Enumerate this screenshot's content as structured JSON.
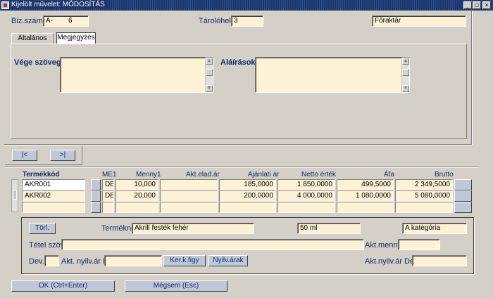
{
  "window": {
    "title": "Kijelölt művelet: MÓDOSÍTÁS",
    "minimize": "_",
    "maximize": "□",
    "close": "×"
  },
  "header": {
    "biz_szam_label": "Biz.szám",
    "biz_szam_prefix": "A-",
    "biz_szam_value": "6",
    "tarolohely_label": "Tárolóhely",
    "tarolohely_value": "3",
    "raktar_value": "Főraktár"
  },
  "tabs": [
    {
      "label": "Általános"
    },
    {
      "label": "Megjegyzés"
    }
  ],
  "notes": {
    "vege_szoveg_label": "Vége szöveg",
    "alairasok_label": "Aláírások",
    "scroll_up": "▲",
    "scroll_down": "▼"
  },
  "nav": {
    "first": "|<",
    "last": ">|"
  },
  "grid": {
    "columns": [
      "Termékkód",
      "ME1",
      "Menny1",
      "Akt.elad.ár",
      "Ajánlati ár",
      "Netto érték",
      "Áfa",
      "Brutto"
    ],
    "rows": [
      {
        "kod": "AKR001",
        "me": "DB",
        "menny": "10,000",
        "akt_ar": "",
        "ajanl": "185,0000",
        "netto": "1 850,0000",
        "afa": "499,5000",
        "brutto": "2 349,5000"
      },
      {
        "kod": "AKR002",
        "me": "DB",
        "menny": "20,000",
        "akt_ar": "",
        "ajanl": "200,0000",
        "netto": "4 000,0000",
        "afa": "1 080,0000",
        "brutto": "5 080,0000"
      },
      {
        "kod": "",
        "me": "",
        "menny": "",
        "akt_ar": "",
        "ajanl": "",
        "netto": "",
        "afa": "",
        "brutto": ""
      }
    ]
  },
  "detail": {
    "torl_label": "Törl.",
    "termeknev_label": "Terméknév",
    "termeknev_value": "Akrill festék fehér",
    "kiszereles_value": "50 ml",
    "kategoria_value": "A kategória",
    "tetel_szov_label": "Tétel szöv.",
    "tetel_szov_value": "",
    "akt_menny_label": "Akt.menny",
    "akt_menny_value": "",
    "dev_label": "Dev.:",
    "dev_value": "",
    "akt_nyilv_ar_ft_label": "Akt. nyilv.ár Ft.",
    "akt_nyilv_ar_ft_value": "",
    "ker_k_figy_label": "Ker.k.figy",
    "nyilv_arak_label": "Nyilv.árak",
    "akt_nyilv_ar_dev_label": "Akt.nyilv.ár Dev.",
    "akt_nyilv_ar_dev_value": ""
  },
  "footer": {
    "ok_label": "OK (Ctrl+Enter)",
    "cancel_label": "Mégsem (Esc)"
  }
}
